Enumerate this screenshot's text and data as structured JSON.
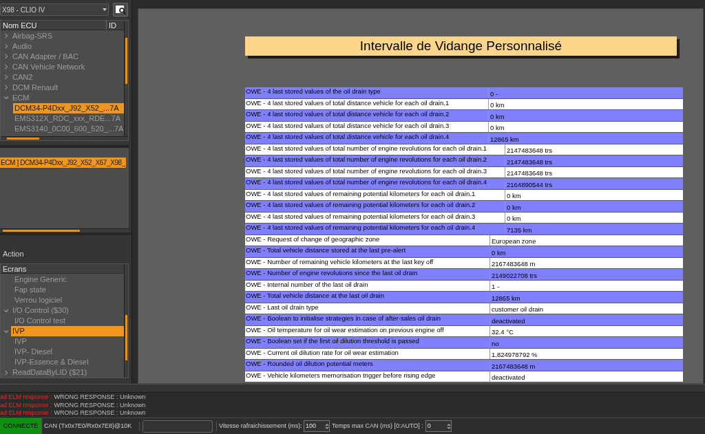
{
  "vehicle_select": {
    "value": "X98 - CLIO IV"
  },
  "ecu_tree": {
    "columns": [
      "Nom ECU",
      "ID"
    ],
    "items": [
      {
        "label": "Airbag-SRS",
        "expanded": false,
        "selected": false
      },
      {
        "label": "Audio",
        "expanded": false,
        "selected": false
      },
      {
        "label": "CAN Adapter / BAC",
        "expanded": false,
        "selected": false
      },
      {
        "label": "CAN Vehicle Network",
        "expanded": false,
        "selected": false
      },
      {
        "label": "CAN2",
        "expanded": false,
        "selected": false
      },
      {
        "label": "DCM Renault",
        "expanded": false,
        "selected": false
      },
      {
        "label": "ECM",
        "expanded": true,
        "selected": false,
        "children": [
          {
            "label": "DCM34-P4Dxx_J92_X52_...",
            "id": "7A",
            "selected": true
          },
          {
            "label": "EMS312X_RDC_xxx_RDE...",
            "id": "7A",
            "selected": false
          },
          {
            "label": "EMS3140_0C00_600_520_...",
            "id": "7A",
            "selected": false
          }
        ]
      }
    ]
  },
  "connected_ecus": [
    {
      "label": "ECM ] DCM34-P4Dxx_J92_X52_X67_X98_",
      "selected": true
    }
  ],
  "action_panel": {
    "title": "Action",
    "tree": {
      "column": "Ecrans",
      "items": [
        {
          "children": [
            {
              "label": "Engine Generic",
              "selected": false
            },
            {
              "label": "Fap state",
              "selected": false
            },
            {
              "label": "Verrou logiciel",
              "selected": false
            }
          ]
        },
        {
          "label": "I/O Control ($30)",
          "expanded": true,
          "selected": false,
          "children": [
            {
              "label": "I/O Control test",
              "selected": false
            }
          ]
        },
        {
          "label": "IVP",
          "expanded": true,
          "selected": true,
          "children": [
            {
              "label": "IVP",
              "selected": false
            },
            {
              "label": "IVP- Diesel",
              "selected": false
            },
            {
              "label": "IVP-Essence & Diesel",
              "selected": false
            }
          ]
        },
        {
          "label": "ReadDataByLID ($21)",
          "expanded": false,
          "selected": false
        }
      ]
    }
  },
  "screen": {
    "title": "Intervalle de Vidange Personnalisé",
    "rows": [
      {
        "kind": "short",
        "highlighted": true,
        "label": "OWE - 4 last stored values of the oil drain type",
        "value": "0 -"
      },
      {
        "kind": "short",
        "highlighted": false,
        "label": "OWE - 4 last stored values of total distance vehicle for each oil drain.1",
        "value": "0 km"
      },
      {
        "kind": "short",
        "highlighted": true,
        "label": "OWE - 4 last stored values of total distance vehicle for each oil drain.2",
        "value": "0 km"
      },
      {
        "kind": "short",
        "highlighted": false,
        "label": "OWE - 4 last stored values of total distance vehicle for each oil drain.3",
        "value": "0 km"
      },
      {
        "kind": "short",
        "highlighted": true,
        "label": "OWE - 4 last stored values of total distance vehicle for each oil drain.4",
        "value": "12865 km"
      },
      {
        "kind": "long",
        "highlighted": false,
        "label": "OWE - 4 last stored values of total number of engine revolutions for each oil drain.1",
        "value": "2147483648 trs"
      },
      {
        "kind": "long",
        "highlighted": true,
        "label": "OWE - 4 last stored values of total number of engine revolutions for each oil drain.2",
        "value": "2147483648 trs"
      },
      {
        "kind": "long",
        "highlighted": false,
        "label": "OWE - 4 last stored values of total number of engine revolutions for each oil drain.3",
        "value": "2147483648 trs"
      },
      {
        "kind": "long",
        "highlighted": true,
        "label": "OWE - 4 last stored values of total number of engine revolutions for each oil drain.4",
        "value": "2164890544 trs"
      },
      {
        "kind": "long",
        "highlighted": false,
        "label": "OWE - 4 last stored values of remaining potential kilometers for each oil drain.1",
        "value": "0 km"
      },
      {
        "kind": "long",
        "highlighted": true,
        "label": "OWE - 4 last stored values of remaining potential kilometers for each oil drain.2",
        "value": "0 km"
      },
      {
        "kind": "long",
        "highlighted": false,
        "label": "OWE - 4 last stored values of remaining potential kilometers for each oil drain.3",
        "value": "0 km"
      },
      {
        "kind": "long",
        "highlighted": true,
        "label": "OWE - 4 last stored values of remaining potential kilometers for each oil drain.4",
        "value": "7135 km"
      },
      {
        "kind": "medium",
        "highlighted": false,
        "label": "OWE - Request of change of geographic zone",
        "value": "European zone"
      },
      {
        "kind": "medium",
        "highlighted": true,
        "label": "OWE - Total vehicle distance stored at the last pre-alert",
        "value": "0 km"
      },
      {
        "kind": "medium",
        "highlighted": false,
        "label": "OWE - Number of remaining vehicle kilometers at the last key off",
        "value": "2167483648 m"
      },
      {
        "kind": "medium",
        "highlighted": true,
        "label": "OWE - Number of engine revolutions since the last oil drain",
        "value": "2149022708 trs"
      },
      {
        "kind": "medium",
        "highlighted": false,
        "label": "OWE - Internal number of the last oil drain",
        "value": "1 -"
      },
      {
        "kind": "medium",
        "highlighted": true,
        "label": "OWE - Total vehicle distance at the last oil drain",
        "value": "12865 km"
      },
      {
        "kind": "medium",
        "highlighted": false,
        "label": "OWE - Last oil drain type",
        "value": "customer oil drain"
      },
      {
        "kind": "medium",
        "highlighted": true,
        "label": "OWE - Boolean to initialise strategies in case of after-sales oil drain",
        "value": "deactivated"
      },
      {
        "kind": "medium",
        "highlighted": false,
        "label": "OWE - Oil temperature for oil wear estimation on previous engine off",
        "value": "32.4 °C"
      },
      {
        "kind": "medium",
        "highlighted": true,
        "label": "OWE - Boolean set if the first oil dilution threshold is passed",
        "value": "no"
      },
      {
        "kind": "medium",
        "highlighted": false,
        "label": "OWE - Current oil dilution rate for oil wear estimation",
        "value": "1.824978792 %"
      },
      {
        "kind": "medium",
        "highlighted": true,
        "label": "OWE - Rounded oil dilution potential meters",
        "value": "2167483648 m"
      },
      {
        "kind": "medium",
        "highlighted": false,
        "label": "OWE - Vehicle kilometers memorisation trigger before rising edge",
        "value": "deactivated"
      }
    ]
  },
  "log": [
    {
      "prefix": "ad ELM response :",
      "message": "WRONG RESPONSE : Unknown"
    },
    {
      "prefix": "ad ELM response :",
      "message": "WRONG RESPONSE : Unknown"
    },
    {
      "prefix": "ad ELM response :",
      "message": "WRONG RESPONSE : Unknown"
    }
  ],
  "status_bar": {
    "connection": {
      "label": "CONNECTÉ",
      "connected": true
    },
    "can_info": "CAN (Tx0x7E0/Rx0x7E8)@10K",
    "refresh_label": "Vitesse rafraichissement (ms):",
    "refresh_value": "100",
    "can_timeout_label": "Temps max CAN (ms) [0:AUTO] :",
    "can_timeout_value": "0"
  }
}
